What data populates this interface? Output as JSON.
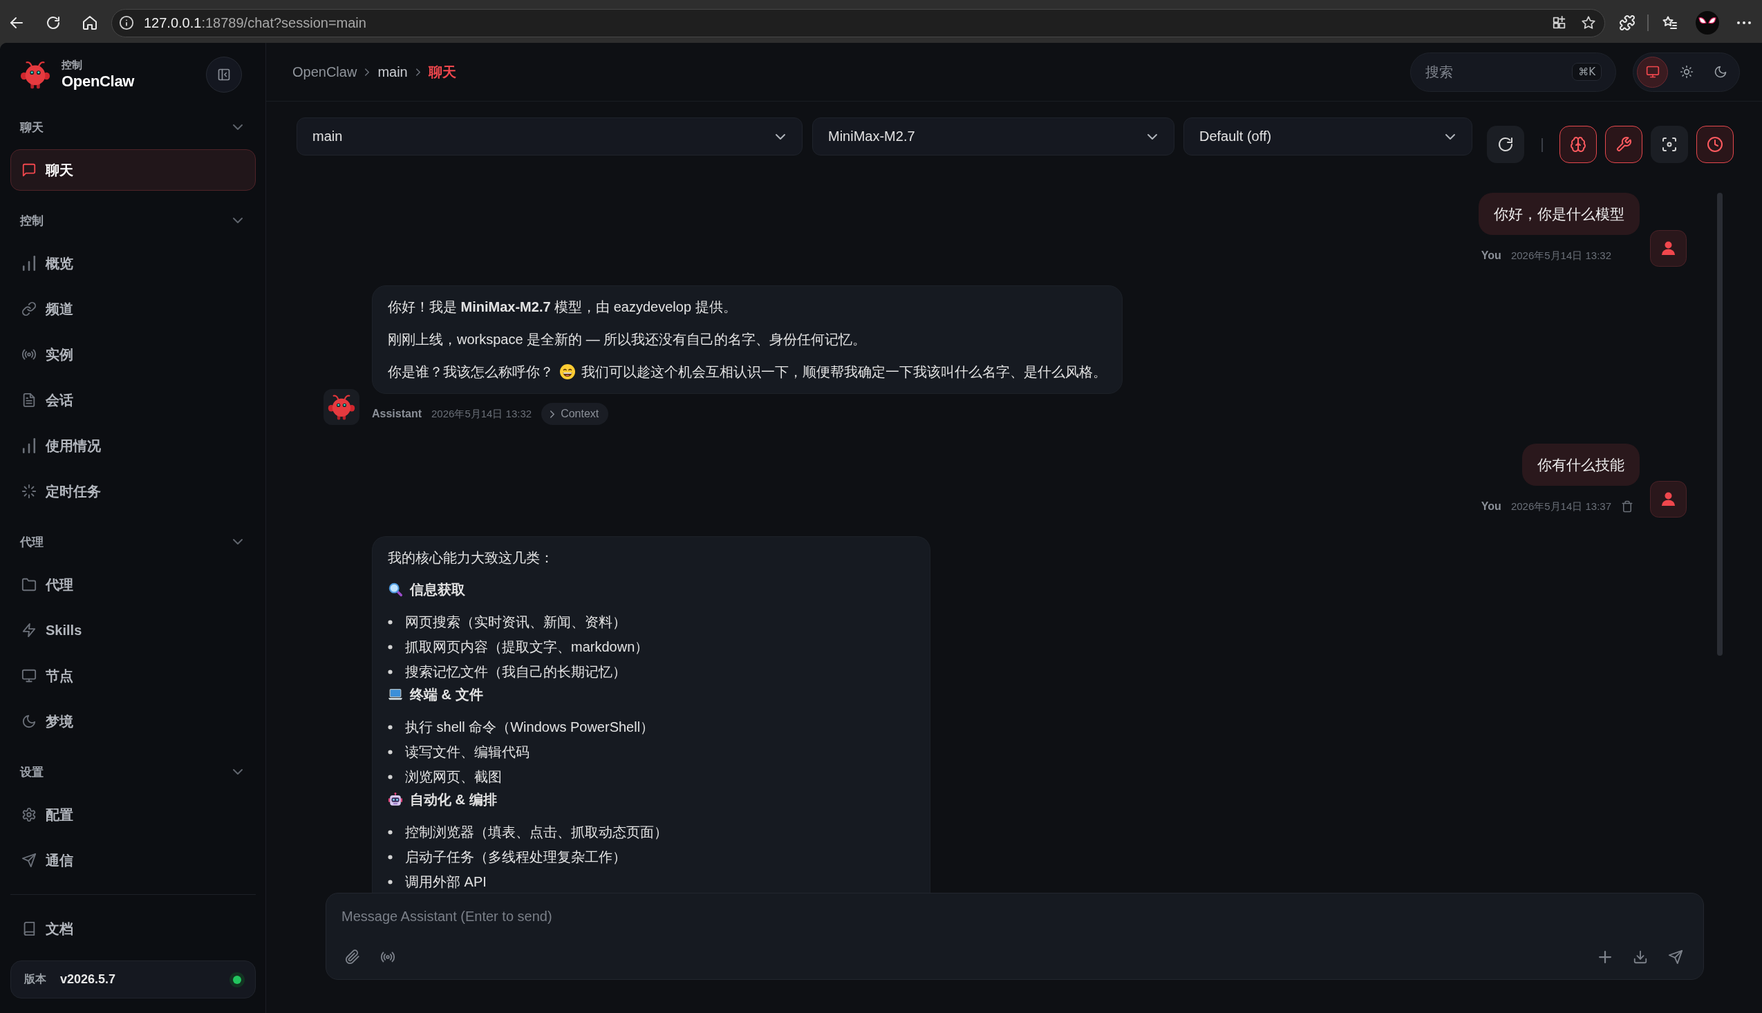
{
  "browser": {
    "url_host": "127.0.0.1",
    "url_rest": ":18789/chat?session=main"
  },
  "sidebar": {
    "brand": {
      "caption": "控制",
      "name": "OpenClaw"
    },
    "sections": [
      {
        "title": "聊天",
        "expanded": true,
        "items": [
          {
            "kind": "chat",
            "label": "聊天",
            "selected": true
          }
        ]
      },
      {
        "title": "控制",
        "expanded": true,
        "items": [
          {
            "kind": "overview",
            "label": "概览",
            "selected": false
          },
          {
            "kind": "channels",
            "label": "频道",
            "selected": false
          },
          {
            "kind": "instances",
            "label": "实例",
            "selected": false
          },
          {
            "kind": "sessions",
            "label": "会话",
            "selected": false
          },
          {
            "kind": "usage",
            "label": "使用情况",
            "selected": false
          },
          {
            "kind": "cron",
            "label": "定时任务",
            "selected": false
          }
        ]
      },
      {
        "title": "代理",
        "expanded": true,
        "items": [
          {
            "kind": "agents",
            "label": "代理",
            "selected": false
          },
          {
            "kind": "skills",
            "label": "Skills",
            "selected": false
          },
          {
            "kind": "nodes",
            "label": "节点",
            "selected": false
          },
          {
            "kind": "dreams",
            "label": "梦境",
            "selected": false
          }
        ]
      },
      {
        "title": "设置",
        "expanded": true,
        "items": [
          {
            "kind": "config",
            "label": "配置",
            "selected": false
          },
          {
            "kind": "comms",
            "label": "通信",
            "selected": false
          }
        ]
      }
    ],
    "footer_items": [
      {
        "kind": "docs",
        "label": "文档",
        "selected": false
      }
    ],
    "version": {
      "label": "版本",
      "value": "v2026.5.7",
      "online": true
    }
  },
  "header": {
    "breadcrumb": [
      {
        "label": "OpenClaw",
        "current": false
      },
      {
        "label": "main",
        "current": false
      },
      {
        "label": "聊天",
        "current": true
      }
    ],
    "search": {
      "placeholder": "搜索",
      "shortcut": "⌘K"
    },
    "theme_modes": [
      {
        "kind": "system",
        "selected": true
      },
      {
        "kind": "light",
        "selected": false
      },
      {
        "kind": "dark",
        "selected": false
      }
    ]
  },
  "toolbar": {
    "selects": [
      {
        "value": "main"
      },
      {
        "value": "MiniMax-M2.7"
      },
      {
        "value": "Default (off)"
      }
    ],
    "toggles": [
      {
        "kind": "thinking",
        "on": true
      },
      {
        "kind": "tools",
        "on": true
      },
      {
        "kind": "focus",
        "on": false
      },
      {
        "kind": "cron",
        "on": true
      }
    ]
  },
  "messages": [
    {
      "kind": "user",
      "text": "你好，你是什么模型",
      "sender": "You",
      "time": "2026年5月14日 13:32",
      "delete_visible": false
    },
    {
      "kind": "assistant",
      "sender": "Assistant",
      "time": "2026年5月14日 13:32",
      "context": {
        "label": "Context",
        "expanded": false
      },
      "blocks": [
        {
          "kind": "text",
          "text": "你好！我是 **MiniMax-M2.7** 模型，由 eazydevelop 提供。"
        },
        {
          "kind": "text",
          "text": "刚刚上线，workspace 是全新的 — 所以我还没有自己的名字、身份任何记忆。"
        },
        {
          "kind": "emoji_text",
          "before": "你是谁？我该怎么称呼你？",
          "after": "我们可以趁这个机会互相认识一下，顺便帮我确定一下我该叫什么名字、是什么风格。"
        }
      ]
    },
    {
      "kind": "user",
      "text": "你有什么技能",
      "sender": "You",
      "time": "2026年5月14日 13:37",
      "delete_visible": true
    },
    {
      "kind": "assistant",
      "blocks": [
        {
          "kind": "text",
          "text": "我的核心能力大致这几类："
        },
        {
          "kind": "heading",
          "text": "信息获取"
        },
        {
          "kind": "bullets",
          "items": [
            "网页搜索（实时资讯、新闻、资料）",
            "抓取网页内容（提取文字、markdown）",
            "搜索记忆文件（我自己的长期记忆）"
          ]
        },
        {
          "kind": "heading",
          "text": "终端 & 文件"
        },
        {
          "kind": "bullets",
          "items": [
            "执行 shell 命令（Windows PowerShell）",
            "读写文件、编辑代码",
            "浏览网页、截图"
          ]
        },
        {
          "kind": "heading",
          "text": "自动化 & 编排"
        },
        {
          "kind": "bullets",
          "items": [
            "控制浏览器（填表、点击、抓取动态页面）",
            "启动子任务（多线程处理复杂工作）",
            "调用外部 API"
          ]
        }
      ]
    }
  ],
  "composer": {
    "placeholder": "Message Assistant (Enter to send)"
  }
}
